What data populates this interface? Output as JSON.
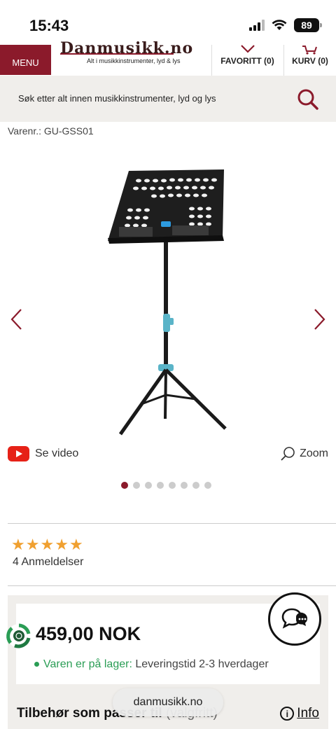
{
  "status_bar": {
    "time": "15:43",
    "battery": "89",
    "icons": [
      "signal-icon",
      "wifi-icon",
      "battery-icon"
    ]
  },
  "header": {
    "menu_label": "MENU",
    "logo_text": "Danmusikk.no",
    "logo_tagline": "Alt i musikkinstrumenter, lyd & lys",
    "favorites_label": "FAVORITT (0)",
    "cart_label": "KURV (0)"
  },
  "search": {
    "placeholder": "Søk etter alt innen musikkinstrumenter, lyd og lys",
    "icon": "search-icon"
  },
  "product": {
    "sku": "Varenr.: GU-GSS01",
    "video_label": "Se video",
    "zoom_label": "Zoom",
    "image_count": 8,
    "active_image": 1
  },
  "rating": {
    "stars": 5,
    "reviews_label": "4 Anmeldelser"
  },
  "purchase": {
    "price": "459,00 NOK",
    "stock_status": "Varen er på lager:",
    "delivery_time": "Leveringstid 2-3 hverdager"
  },
  "accessories": {
    "title": "Tilbehør som passer til",
    "subtitle": "(valgfritt)",
    "info_label": "Info"
  },
  "browser": {
    "domain": "danmusikk.no"
  },
  "colors": {
    "brand": "#8b1a2b",
    "in_stock": "#2a9d55",
    "star": "#f0a030",
    "panel_bg": "#f0eeeb"
  }
}
